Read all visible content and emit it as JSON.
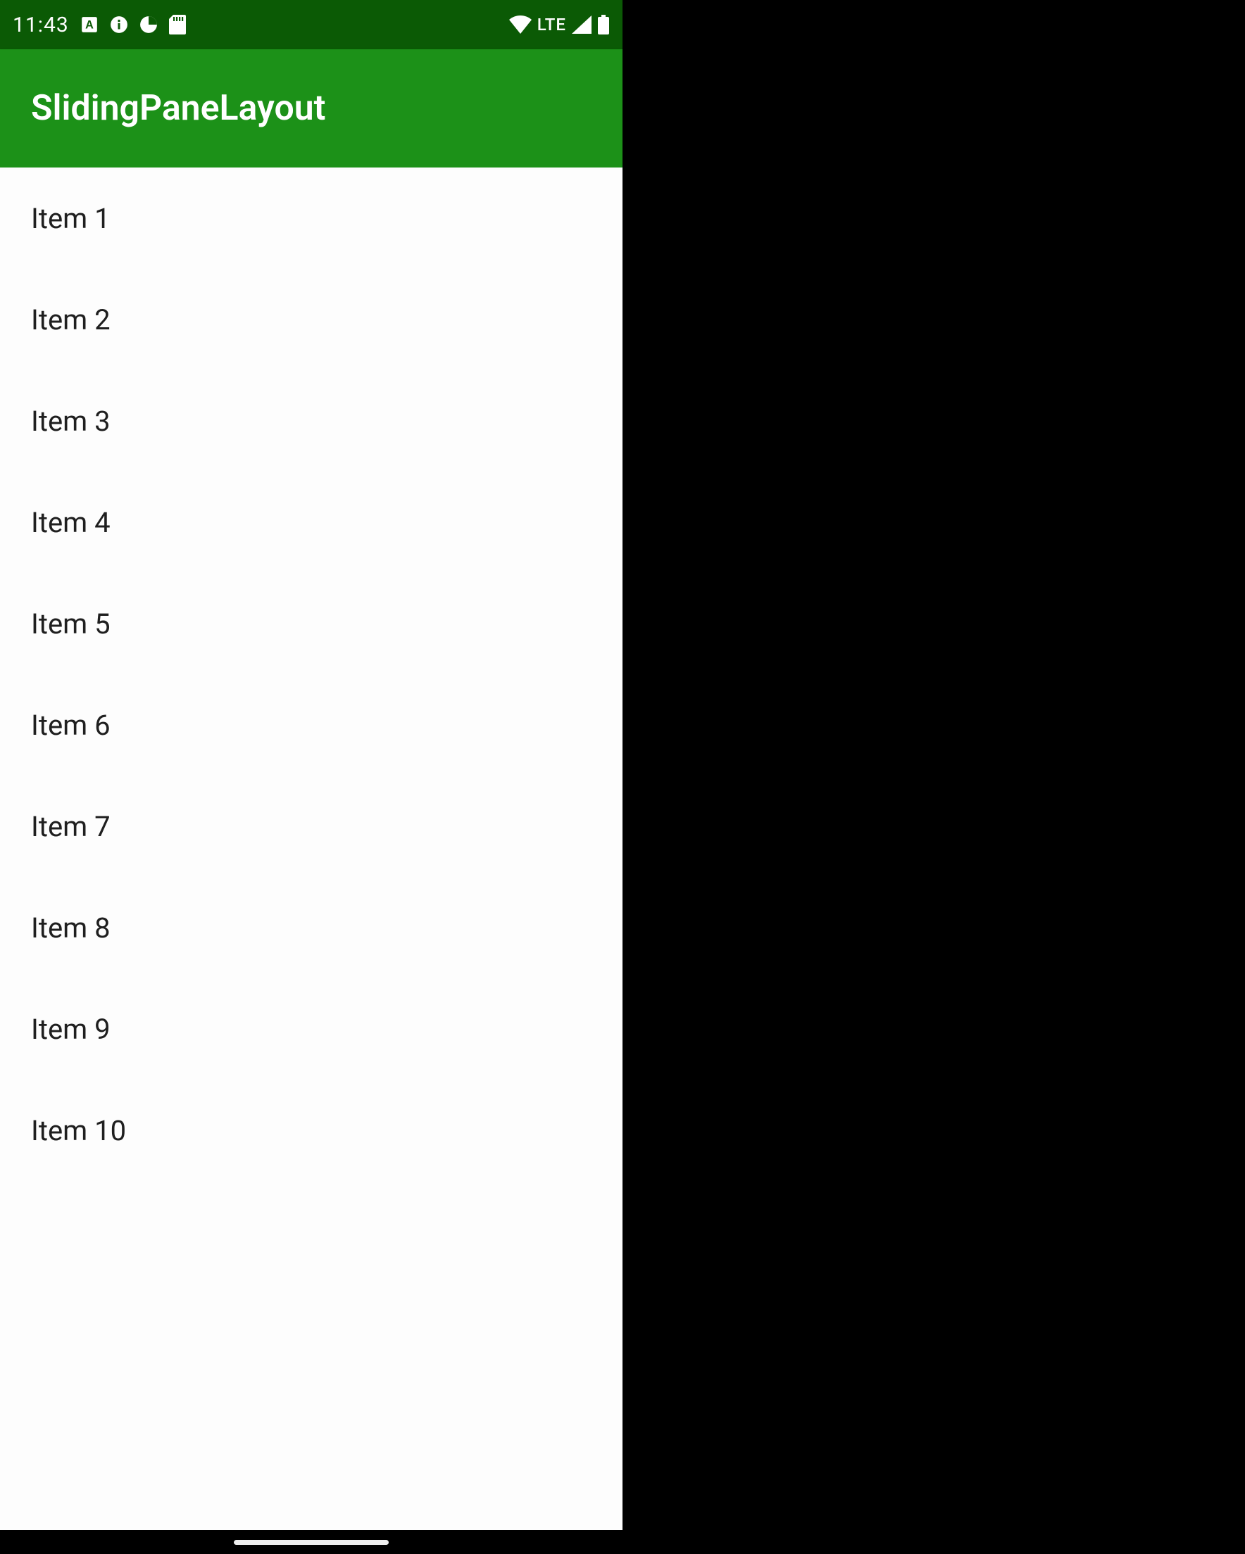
{
  "status_bar": {
    "time": "11:43",
    "network_label": "LTE"
  },
  "app_bar": {
    "title": "SlidingPaneLayout"
  },
  "list": {
    "items": [
      {
        "label": "Item 1"
      },
      {
        "label": "Item 2"
      },
      {
        "label": "Item 3"
      },
      {
        "label": "Item 4"
      },
      {
        "label": "Item 5"
      },
      {
        "label": "Item 6"
      },
      {
        "label": "Item 7"
      },
      {
        "label": "Item 8"
      },
      {
        "label": "Item 9"
      },
      {
        "label": "Item 10"
      }
    ]
  }
}
